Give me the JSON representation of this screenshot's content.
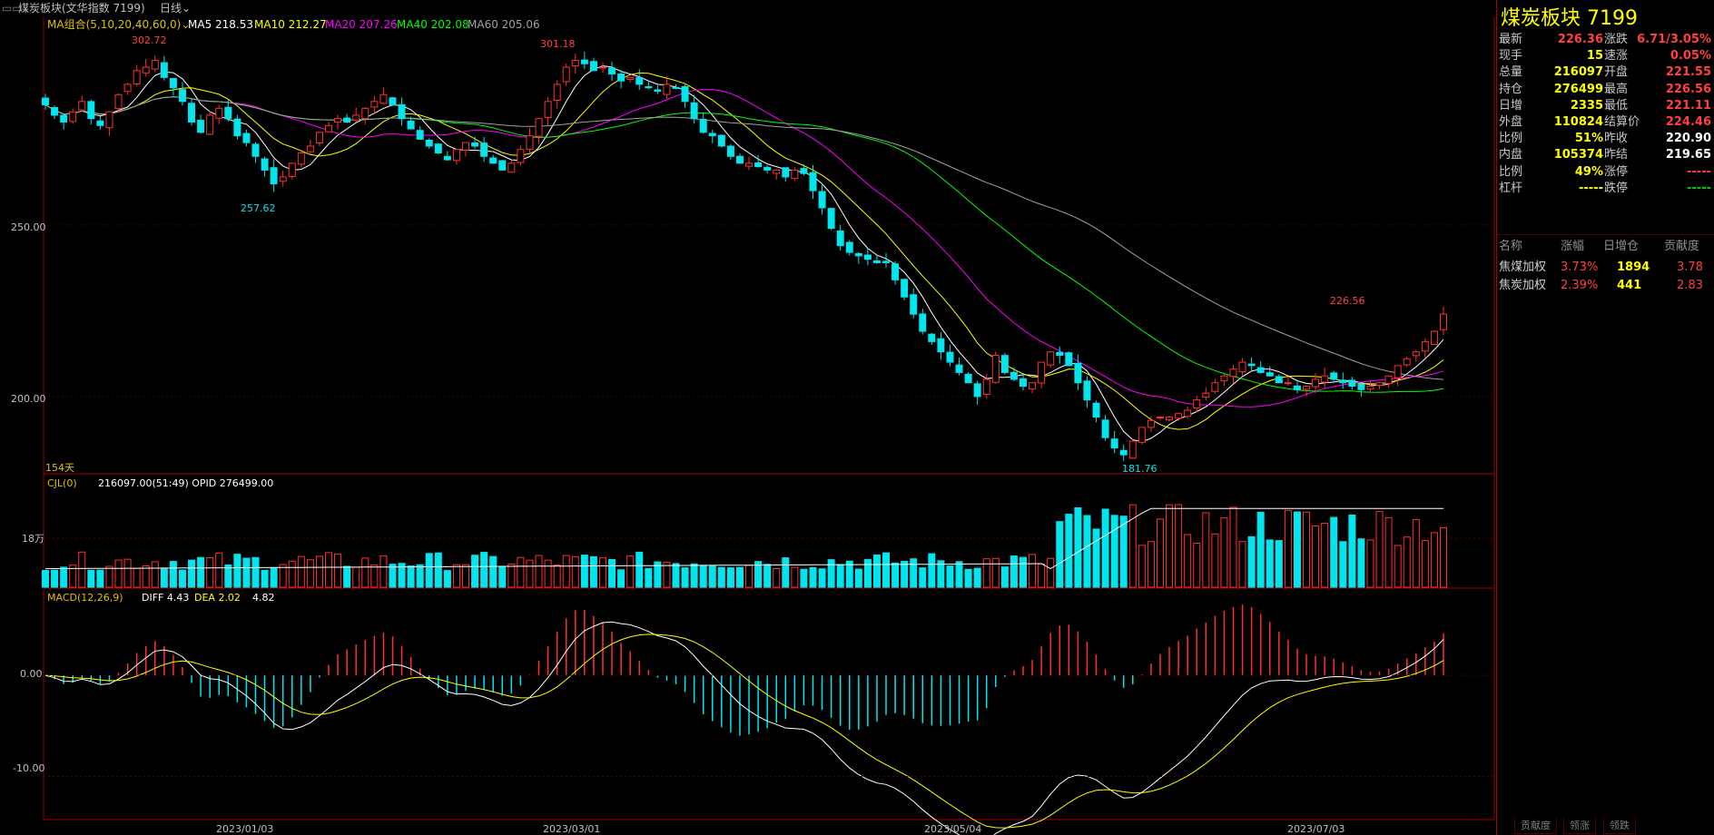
{
  "header": {
    "title": "煤炭板块(文华指数 7199)",
    "period": "日线"
  },
  "ma_legend": {
    "group": "MA组合(5,10,20,40,60,0)",
    "ma5": "MA5 218.53",
    "ma10": "MA10 212.27",
    "ma20": "MA20 207.26",
    "ma40": "MA40 202.08",
    "ma60": "MA60 205.06",
    "colors": {
      "ma5": "#ffffff",
      "ma10": "#ffff00",
      "ma20": "#ff00ff",
      "ma40": "#00ff00",
      "ma60": "#a0a0a0"
    }
  },
  "price_pane": {
    "y_ticks": [
      "250.00",
      "200.00"
    ],
    "annotations": {
      "high1": "302.72",
      "high2": "301.18",
      "low1": "257.62",
      "low2": "181.76",
      "last_high": "226.56"
    },
    "days_label": "154天"
  },
  "volume_pane": {
    "legend_name": "CJL(0)",
    "legend_values": "216097.00(51:49)  OPID 276499.00",
    "y_tick": "18万"
  },
  "macd_pane": {
    "legend_name": "MACD(12,26,9)",
    "diff": "DIFF 4.43",
    "dea": "DEA 2.02",
    "macd": "4.82",
    "y_ticks": [
      "0.00",
      "-10.00"
    ]
  },
  "x_axis": {
    "labels": [
      "2023/01/03",
      "2023/03/01",
      "2023/05/04",
      "2023/07/03"
    ]
  },
  "chart_data": {
    "type": "candlestick",
    "title": "煤炭板块(文华指数 7199)",
    "period": "日线",
    "ylim": [
      178,
      305
    ],
    "y_ticks": [
      250,
      200
    ],
    "highs_labeled": [
      302.72,
      301.18,
      226.56
    ],
    "lows_labeled": [
      257.62,
      181.76
    ],
    "ma_last": {
      "MA5": 218.53,
      "MA10": 212.27,
      "MA20": 207.26,
      "MA40": 202.08,
      "MA60": 205.06
    },
    "close_approx": [
      285,
      282,
      280,
      283,
      286,
      281,
      279,
      283,
      288,
      291,
      295,
      296,
      298,
      293,
      290,
      286,
      280,
      277,
      282,
      284,
      281,
      276,
      274,
      270,
      266,
      262,
      264,
      268,
      271,
      273,
      277,
      279,
      281,
      280,
      282,
      284,
      286,
      288,
      285,
      281,
      278,
      275,
      273,
      271,
      269,
      272,
      274,
      273,
      270,
      268,
      266,
      268,
      272,
      276,
      281,
      286,
      291,
      296,
      298,
      297,
      295,
      296,
      294,
      292,
      293,
      291,
      290,
      289,
      291,
      290,
      286,
      281,
      277,
      276,
      273,
      270,
      268,
      268,
      267,
      266,
      266,
      264,
      266,
      265,
      260,
      255,
      249,
      244,
      242,
      241,
      240,
      239,
      239,
      234,
      229,
      224,
      219,
      216,
      213,
      210,
      207,
      204,
      200,
      205,
      212,
      207,
      205,
      203,
      204,
      210,
      213,
      212,
      209,
      204,
      199,
      194,
      188,
      185,
      183,
      187,
      191,
      193,
      194,
      194,
      195,
      196,
      199,
      201,
      204,
      206,
      208,
      210,
      209,
      207,
      206,
      204,
      204,
      202,
      203,
      205,
      206,
      205,
      204,
      203,
      202,
      203,
      204,
      206,
      209,
      211,
      213,
      216,
      219,
      224
    ],
    "volume": {
      "name": "CJL",
      "value": 216097,
      "ratio": "51:49",
      "opid": 276499
    },
    "macd": {
      "diff": 4.43,
      "dea": 2.02,
      "macd": 4.82,
      "ylim": [
        -14,
        8
      ]
    }
  },
  "quote_panel": {
    "title": "煤炭板块 7199",
    "rows": [
      {
        "l1": "最新",
        "v1": "226.36",
        "c1": "red",
        "l2": "涨跌",
        "v2": "6.71/3.05%",
        "c2": "red"
      },
      {
        "l1": "现手",
        "v1": "15",
        "c1": "yellow",
        "l2": "速涨",
        "v2": "0.05%",
        "c2": "red"
      },
      {
        "l1": "总量",
        "v1": "216097",
        "c1": "yellow",
        "l2": "开盘",
        "v2": "221.55",
        "c2": "red"
      },
      {
        "l1": "持仓",
        "v1": "276499",
        "c1": "yellow",
        "l2": "最高",
        "v2": "226.56",
        "c2": "red"
      },
      {
        "l1": "日增",
        "v1": "2335",
        "c1": "yellow",
        "l2": "最低",
        "v2": "221.11",
        "c2": "red"
      },
      {
        "l1": "外盘",
        "v1": "110824",
        "c1": "yellow",
        "l2": "结算价",
        "v2": "224.46",
        "c2": "red"
      },
      {
        "l1": "比例",
        "v1": "51%",
        "c1": "yellow",
        "l2": "昨收",
        "v2": "220.90",
        "c2": "white"
      },
      {
        "l1": "内盘",
        "v1": "105374",
        "c1": "yellow",
        "l2": "昨结",
        "v2": "219.65",
        "c2": "white"
      },
      {
        "l1": "比例",
        "v1": "49%",
        "c1": "yellow",
        "l2": "涨停",
        "v2": "-----",
        "c2": "red"
      },
      {
        "l1": "杠杆",
        "v1": "-----",
        "c1": "yellow",
        "l2": "跌停",
        "v2": "-----",
        "c2": "green"
      }
    ],
    "contrib_header": [
      "名称",
      "涨幅",
      "日增仓",
      "贡献度"
    ],
    "contrib_rows": [
      {
        "name": "焦煤加权",
        "pct": "3.73%",
        "inc": "1894",
        "contrib": "3.78"
      },
      {
        "name": "焦炭加权",
        "pct": "2.39%",
        "inc": "441",
        "contrib": "2.83"
      }
    ]
  },
  "bottom_tabs": [
    "贡献度",
    "领涨",
    "领跌"
  ]
}
